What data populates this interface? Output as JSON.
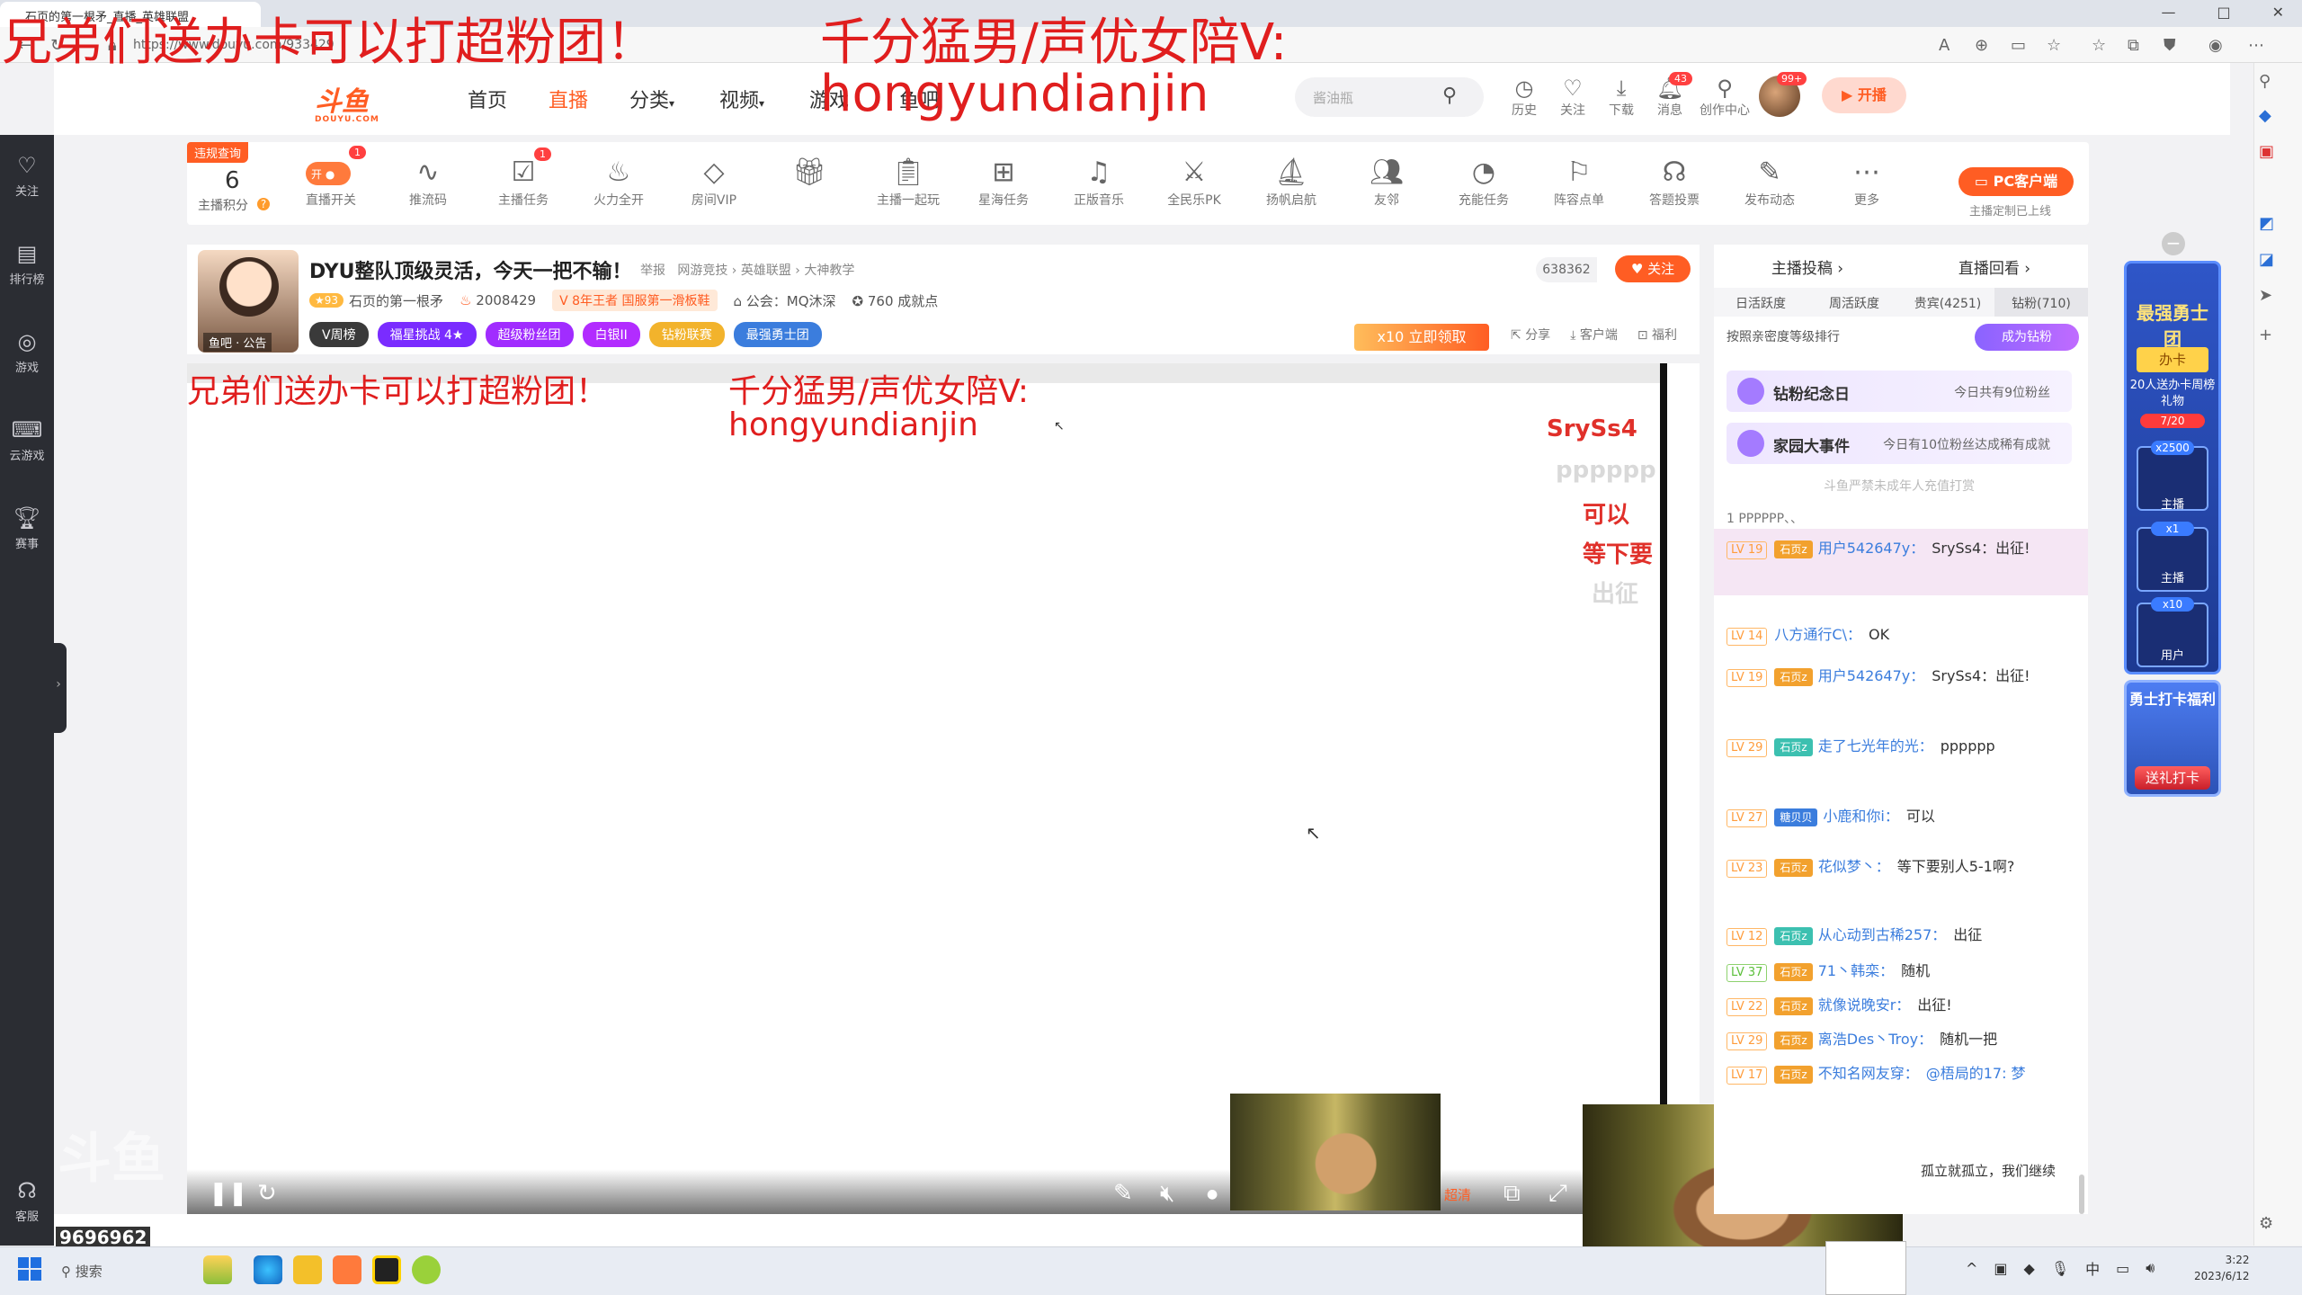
{
  "browser": {
    "tab_title": "石页的第一根矛_直播_英雄联盟",
    "url": "https://www.douyu.com/933429",
    "window_controls": [
      "—",
      "□",
      "✕"
    ]
  },
  "overlays": {
    "top_left": "兄弟们送办卡可以打超粉团！",
    "top_center_line1": "千分猛男/声优女陪V:",
    "top_center_line2": "hongyundianjin",
    "video_left": "兄弟们送办卡可以打超粉团！",
    "video_center_line1": "千分猛男/声优女陪V:",
    "video_center_line2": "hongyundianjin"
  },
  "left_rail": [
    {
      "label": "关注",
      "icon": "heart-icon"
    },
    {
      "label": "排行榜",
      "icon": "ranking-icon"
    },
    {
      "label": "游戏",
      "icon": "game-icon"
    },
    {
      "label": "云游戏",
      "icon": "cloud-game-icon"
    },
    {
      "label": "赛事",
      "icon": "trophy-icon"
    },
    {
      "label": "客服",
      "icon": "support-icon"
    }
  ],
  "header": {
    "logo_text": "斗鱼",
    "logo_sub": "DOUYU.COM",
    "nav": [
      "首页",
      "直播",
      "分类",
      "视频",
      "游戏",
      "鱼吧"
    ],
    "active_nav": "直播",
    "search_placeholder": "酱油瓶",
    "icons": [
      {
        "label": "历史",
        "icon": "history-icon"
      },
      {
        "label": "关注",
        "icon": "heart-icon"
      },
      {
        "label": "下载",
        "icon": "download-icon"
      },
      {
        "label": "消息",
        "icon": "bell-icon"
      },
      {
        "label": "创作中心",
        "icon": "bulb-icon"
      }
    ],
    "message_badge": "43",
    "avatar_badge": "99+",
    "live_button": "开播"
  },
  "streamer_bar": {
    "violation": "违规查询",
    "score": "6",
    "score_label": "主播积分",
    "switch_label": "开",
    "tools": [
      {
        "label": "直播开关",
        "icon": "switch-icon",
        "badge": "1"
      },
      {
        "label": "推流码",
        "icon": "waveform-icon"
      },
      {
        "label": "主播任务",
        "icon": "task-icon",
        "badge": "1"
      },
      {
        "label": "火力全开",
        "icon": "flame-icon"
      },
      {
        "label": "房间VIP",
        "icon": "diamond-icon"
      },
      {
        "label": "",
        "icon": "gift-icon"
      },
      {
        "label": "主播一起玩",
        "icon": "clipboard-icon"
      },
      {
        "label": "星海任务",
        "icon": "ad-icon"
      },
      {
        "label": "正版音乐",
        "icon": "music-icon"
      },
      {
        "label": "全民乐PK",
        "icon": "pk-icon"
      },
      {
        "label": "扬帆启航",
        "icon": "sail-icon"
      },
      {
        "label": "友邻",
        "icon": "users-icon"
      },
      {
        "label": "充能任务",
        "icon": "gauge-icon"
      },
      {
        "label": "阵容点单",
        "icon": "lineup-icon"
      },
      {
        "label": "答题投票",
        "icon": "vote-icon"
      },
      {
        "label": "发布动态",
        "icon": "edit-icon"
      },
      {
        "label": "更多",
        "icon": "more-icon"
      }
    ],
    "pc_client": "PC客户端",
    "pc_client_sub": "主播定制已上线"
  },
  "room": {
    "title": "DYU整队顶级灵活，今天一把不输！",
    "report": "举报",
    "tags": "网游竞技 › 英雄联盟 › 大神教学",
    "fans_count": "638362",
    "follow": "关注",
    "level": "93",
    "streamer_name": "石页的第一根矛",
    "heat": "2008429",
    "rank": "8年王者 国服第一滑板鞋",
    "guild": "公会：MQ沐深",
    "achievements": "760 成就点",
    "avatar_labels": [
      "鱼吧",
      "公告"
    ],
    "pills": [
      {
        "text": "V周榜",
        "color": "#3a3a3a"
      },
      {
        "text": "福星挑战 4★",
        "color": "#7a2cff"
      },
      {
        "text": "超级粉丝团",
        "color": "#a12cff"
      },
      {
        "text": "白银II",
        "color": "#b22cff"
      },
      {
        "text": "钻粉联赛",
        "color": "#f2b32c"
      },
      {
        "text": "最强勇士团",
        "color": "#3b7ddd"
      }
    ],
    "promo_text": "x10 立即领取",
    "actions": [
      "分享",
      "客户端",
      "福利"
    ]
  },
  "danmaku": [
    {
      "text": "SrySs4",
      "color": "#e0302a"
    },
    {
      "text": "pppppp",
      "color": "#d9d9d9"
    },
    {
      "text": "可以",
      "color": "#e0302a"
    },
    {
      "text": "等下要",
      "color": "#e0302a"
    },
    {
      "text": "出征",
      "color": "#d9d9d9"
    }
  ],
  "player": {
    "quality": "超清",
    "watermark": "斗鱼"
  },
  "chat": {
    "top_tabs": [
      "主播投稿 ›",
      "直播回看 ›"
    ],
    "tabs": [
      "日活跃度",
      "周活跃度",
      "贵宾(4251)",
      "钻粉(710)"
    ],
    "rank_hint": "按照亲密度等级排行",
    "become_fan": "成为钻粉",
    "banner1_title": "钻粉纪念日",
    "banner1_sub": "今日共有9位粉丝",
    "banner2_title": "家园大事件",
    "banner2_sub": "今日有10位粉丝达成稀有成就",
    "notice": "斗鱼严禁未成年人充值打赏",
    "rank1": "1   PPPPPP、、",
    "messages": [
      {
        "lv": "LV 19",
        "badge": "石页z",
        "user": "用户542647y：",
        "text": "SrySs4：出征!"
      },
      {
        "lv": "LV 14",
        "badge": "",
        "user": "八方通行C\\：",
        "text": "OK"
      },
      {
        "lv": "LV 19",
        "badge": "石页z",
        "user": "用户542647y：",
        "text": "SrySs4：出征!"
      },
      {
        "lv": "LV 29",
        "badge": "石页z",
        "user": "走了七光年的光：",
        "text": "pppppp"
      },
      {
        "lv": "LV 27",
        "badge": "糖贝贝",
        "user": "小鹿和你i：",
        "text": "可以"
      },
      {
        "lv": "LV 23",
        "badge": "石页z",
        "user": "花似梦丶：",
        "text": "等下要别人5-1啊?"
      },
      {
        "lv": "LV 12",
        "badge": "石页z",
        "user": "从心动到古稀257：",
        "text": "出征"
      },
      {
        "lv": "LV 37",
        "badge": "石页z",
        "user": "71丶韩栾：",
        "text": "随机"
      },
      {
        "lv": "LV 22",
        "badge": "石页z",
        "user": "就像说晚安r：",
        "text": "出征!"
      },
      {
        "lv": "LV 29",
        "badge": "石页z",
        "user": "离浩Des丶Troy：",
        "text": "随机一把"
      },
      {
        "lv": "LV 17",
        "badge": "石页z",
        "user": "不知名网友穿：",
        "text": "@梧局的17: 梦"
      },
      {
        "lv": "",
        "badge": "",
        "user": "",
        "text": "孤立就孤立，我们继续"
      }
    ]
  },
  "promo": {
    "title": "最强勇士团",
    "card": "办卡",
    "text": "20人送办卡周榜礼物",
    "progress": "7/20",
    "slots": [
      {
        "badge": "x2500",
        "label": "主播"
      },
      {
        "badge": "x1",
        "label": "主播"
      },
      {
        "badge": "x10",
        "label": "用户"
      }
    ],
    "checkin_title": "勇士打卡福利",
    "checkin_btn": "送礼打卡"
  },
  "bottom": {
    "left_number": "9696962"
  },
  "taskbar": {
    "search": "搜索",
    "tray": [
      "^",
      "中"
    ],
    "time": "3:22",
    "date": "2023/6/12"
  }
}
